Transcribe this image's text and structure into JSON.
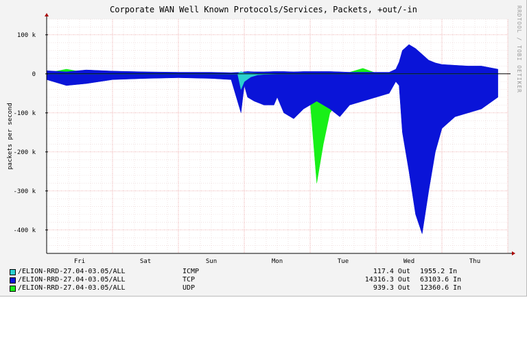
{
  "chart_data": {
    "type": "area",
    "title": "Corporate WAN Well Known Protocols/Services, Packets, +out/-in",
    "side_note": "RRDTOOL / TOBI OETIKER",
    "ylabel": "packets per second",
    "ylim": [
      -460000,
      140000
    ],
    "y_ticks": [
      {
        "value": 100000,
        "label": "100 k"
      },
      {
        "value": 0,
        "label": "0"
      },
      {
        "value": -100000,
        "label": "-100 k"
      },
      {
        "value": -200000,
        "label": "-200 k"
      },
      {
        "value": -300000,
        "label": "-300 k"
      },
      {
        "value": -400000,
        "label": "-400 k"
      }
    ],
    "xlim": [
      0,
      7.0
    ],
    "x_ticks": [
      {
        "value": 0.5,
        "label": "Fri"
      },
      {
        "value": 1.5,
        "label": "Sat"
      },
      {
        "value": 2.5,
        "label": "Sun"
      },
      {
        "value": 3.5,
        "label": "Mon"
      },
      {
        "value": 4.5,
        "label": "Tue"
      },
      {
        "value": 5.5,
        "label": "Wed"
      },
      {
        "value": 6.5,
        "label": "Thu"
      }
    ],
    "grid": true,
    "legend_position": "bottom",
    "colors": {
      "ICMP": "#2bd0d0",
      "TCP": "#0a14d8",
      "UDP": "#18f018"
    },
    "series": [
      {
        "name": "TCP",
        "color": "#0a14d8",
        "x": [
          0.0,
          0.3,
          0.6,
          1.0,
          1.5,
          2.0,
          2.5,
          2.8,
          2.95,
          3.0,
          3.05,
          3.15,
          3.3,
          3.45,
          3.5,
          3.6,
          3.75,
          3.9,
          4.1,
          4.3,
          4.45,
          4.6,
          4.8,
          5.0,
          5.2,
          5.3,
          5.35,
          5.4,
          5.5,
          5.6,
          5.7,
          5.8,
          5.9,
          6.0,
          6.2,
          6.4,
          6.6,
          6.85
        ],
        "out": [
          8000,
          5000,
          10000,
          7000,
          5000,
          4000,
          4000,
          3000,
          4000,
          5000,
          6000,
          5000,
          5000,
          6000,
          6000,
          6000,
          5000,
          6000,
          6000,
          6000,
          5000,
          4000,
          4000,
          4000,
          4000,
          12000,
          30000,
          60000,
          75000,
          65000,
          50000,
          35000,
          28000,
          24000,
          22000,
          20000,
          20000,
          12000
        ],
        "in": [
          -15000,
          -30000,
          -25000,
          -15000,
          -12000,
          -10000,
          -12000,
          -15000,
          -100000,
          -30000,
          -60000,
          -70000,
          -80000,
          -80000,
          -60000,
          -100000,
          -115000,
          -90000,
          -70000,
          -90000,
          -110000,
          -80000,
          -70000,
          -60000,
          -50000,
          -20000,
          -30000,
          -150000,
          -250000,
          -360000,
          -410000,
          -300000,
          -200000,
          -140000,
          -110000,
          -100000,
          -90000,
          -60000
        ]
      },
      {
        "name": "UDP",
        "color": "#18f018",
        "x": [
          0.0,
          0.3,
          0.6,
          1.0,
          1.5,
          2.0,
          2.5,
          3.0,
          3.3,
          3.5,
          3.8,
          4.0,
          4.1,
          4.2,
          4.3,
          4.45,
          4.6,
          4.8,
          5.0,
          5.3,
          5.6,
          6.0,
          6.85
        ],
        "out": [
          2000,
          12000,
          3000,
          6000,
          2000,
          1000,
          1000,
          2000,
          2000,
          2000,
          1000,
          2000,
          2000,
          2000,
          2000,
          3000,
          4000,
          14000,
          2000,
          1000,
          1000,
          1000,
          1000
        ],
        "in": [
          -2000,
          -3000,
          -2000,
          -6000,
          -2000,
          -2000,
          -2000,
          -5000,
          -3000,
          -3000,
          -10000,
          -70000,
          -280000,
          -180000,
          -100000,
          -70000,
          -40000,
          -20000,
          -5000,
          -5000,
          -5000,
          -5000,
          -2000
        ]
      },
      {
        "name": "ICMP",
        "color": "#2bd0d0",
        "x": [
          0.0,
          1.0,
          2.0,
          2.9,
          2.95,
          3.0,
          3.1,
          3.2,
          3.3,
          3.5,
          4.0,
          5.0,
          6.0,
          6.85
        ],
        "out": [
          500,
          500,
          500,
          500,
          6000,
          2000,
          1500,
          1000,
          1000,
          500,
          500,
          500,
          500,
          500
        ],
        "in": [
          -500,
          -500,
          -500,
          -1000,
          -40000,
          -20000,
          -8000,
          -3000,
          -1500,
          -800,
          -500,
          -500,
          -500,
          -500
        ]
      }
    ],
    "legend": [
      {
        "swatch": "#2bd0d0",
        "source": "/ELION-RRD-27.04-03.05/ALL",
        "protocol": "ICMP",
        "out": "117.4 Out",
        "in": "1955.2 In"
      },
      {
        "swatch": "#0a14d8",
        "source": "/ELION-RRD-27.04-03.05/ALL",
        "protocol": "TCP",
        "out": "14316.3 Out",
        "in": "63103.6 In"
      },
      {
        "swatch": "#18f018",
        "source": "/ELION-RRD-27.04-03.05/ALL",
        "protocol": "UDP",
        "out": "939.3 Out",
        "in": "12360.6 In"
      }
    ]
  }
}
